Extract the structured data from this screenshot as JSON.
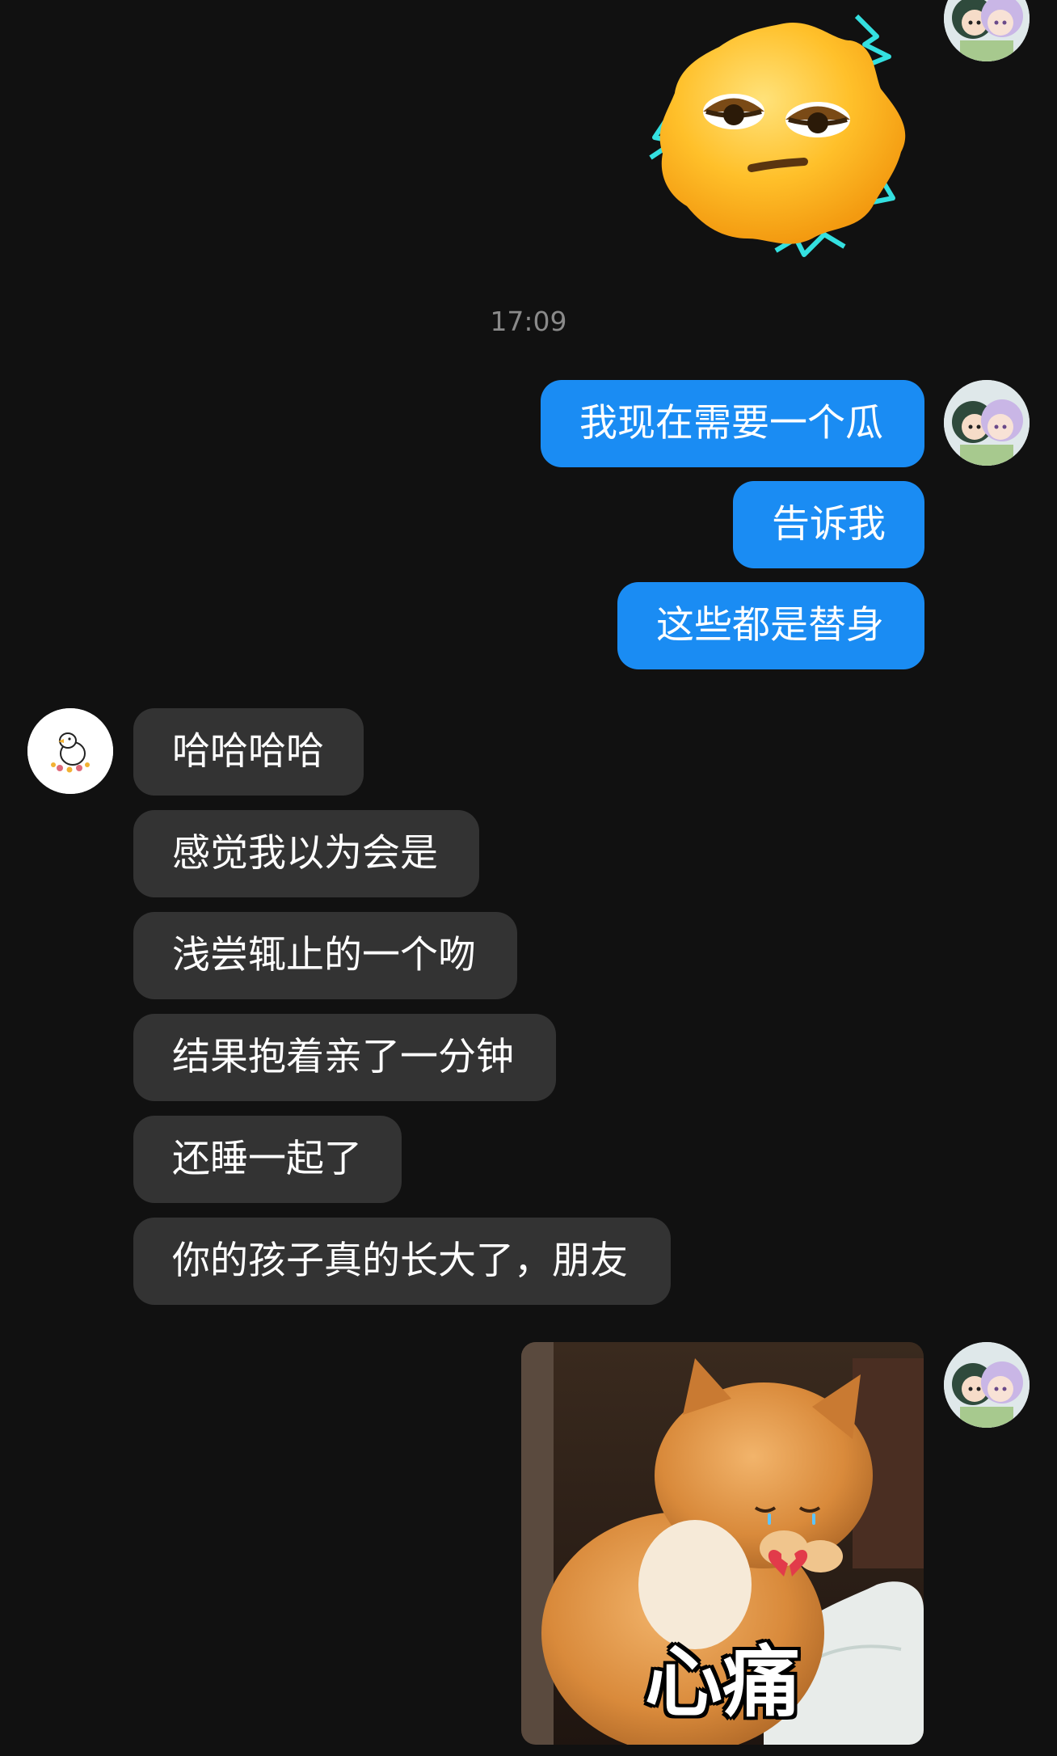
{
  "chat": {
    "timestamp": "17:09",
    "top_sticker": {
      "icon": "sleepy-sun-emoji-icon"
    },
    "me": {
      "avatar": "anime-couple-avatar-icon"
    },
    "friend": {
      "avatar": "duck-avatar-icon"
    },
    "outgoing_group_1": [
      {
        "text": "我现在需要一个瓜"
      },
      {
        "text": "告诉我"
      },
      {
        "text": "这些都是替身"
      }
    ],
    "incoming_group_1": [
      {
        "text": "哈哈哈哈"
      },
      {
        "text": "感觉我以为会是"
      },
      {
        "text": "浅尝辄止的一个吻"
      },
      {
        "text": "结果抱着亲了一分钟"
      },
      {
        "text": "还睡一起了"
      },
      {
        "text": "你的孩子真的长大了，朋友"
      }
    ],
    "meme_sticker": {
      "caption": "心痛",
      "icon": "heartbroken-cat-sticker-icon"
    }
  },
  "colors": {
    "background": "#111111",
    "outgoing_bubble": "#1a8cf3",
    "incoming_bubble": "#333333",
    "timestamp_text": "#8a8a8a"
  }
}
